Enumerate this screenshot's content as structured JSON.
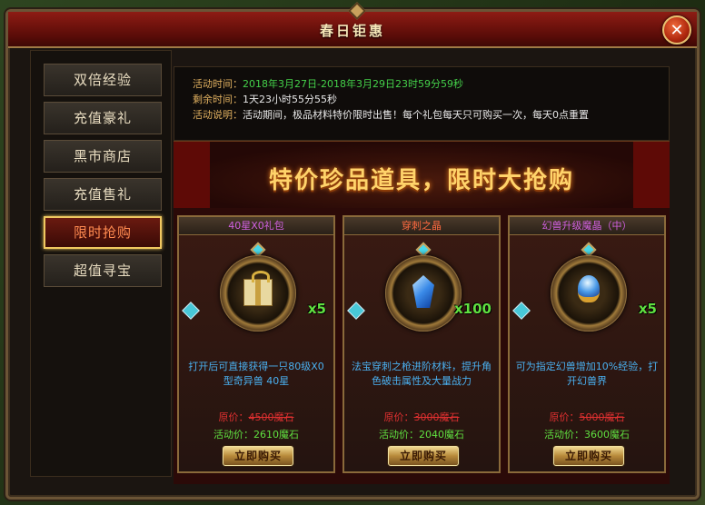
{
  "window": {
    "title": "春日钜惠",
    "close_glyph": "✕"
  },
  "sidebar": {
    "items": [
      {
        "label": "双倍经验",
        "active": false
      },
      {
        "label": "充值豪礼",
        "active": false
      },
      {
        "label": "黑市商店",
        "active": false
      },
      {
        "label": "充值售礼",
        "active": false
      },
      {
        "label": "限时抢购",
        "active": true
      },
      {
        "label": "超值寻宝",
        "active": false
      }
    ]
  },
  "info": {
    "time_label": "活动时间：",
    "time_value": "2018年3月27日-2018年3月29日23时59分59秒",
    "remaining_label": "剩余时间：",
    "remaining_value": "1天23小时55分55秒",
    "desc_label": "活动说明：",
    "desc_value": "活动期间，极品材料特价限时出售！每个礼包每天只可购买一次，每天0点重置"
  },
  "banner": {
    "title": "特价珍品道具，限时大抢购"
  },
  "cards": [
    {
      "name": "40星X0礼包",
      "name_color": "#d060e0",
      "icon": "gift-icon",
      "qty": "x5",
      "desc": "打开后可直接获得一只80级X0型奇异兽 40星",
      "orig_label": "原价：",
      "orig_price": "4500魔石",
      "sale_label": "活动价：",
      "sale_price": "2610魔石",
      "buy_label": "立即购买"
    },
    {
      "name": "穿刺之晶",
      "name_color": "#ff6a40",
      "icon": "crystal-icon",
      "qty": "x100",
      "desc": "法宝穿刺之枪进阶材料，提升角色破击属性及大量战力",
      "orig_label": "原价：",
      "orig_price": "3000魔石",
      "sale_label": "活动价：",
      "sale_price": "2040魔石",
      "buy_label": "立即购买"
    },
    {
      "name": "幻兽升级魔晶（中）",
      "name_color": "#d060e0",
      "icon": "orb-icon",
      "qty": "x5",
      "desc": "可为指定幻兽增加10%经验，打开幻兽界",
      "orig_label": "原价：",
      "orig_price": "5000魔石",
      "sale_label": "活动价：",
      "sale_price": "3600魔石",
      "buy_label": "立即购买"
    }
  ]
}
